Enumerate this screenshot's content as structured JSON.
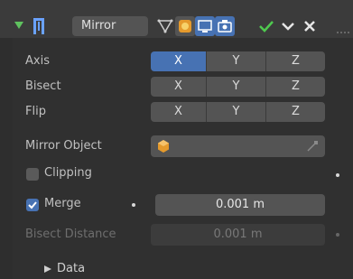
{
  "header": {
    "modifier_name": "Mirror",
    "icons": [
      "expand-arrow-icon",
      "mirror-modifier-icon",
      "edit-mode-cage-icon",
      "on-cage-icon",
      "realtime-display-icon",
      "render-icon",
      "apply-checkmark-icon",
      "dropdown-icon",
      "close-icon"
    ]
  },
  "properties": {
    "axis": {
      "label": "Axis",
      "options": [
        "X",
        "Y",
        "Z"
      ],
      "active": "X"
    },
    "bisect": {
      "label": "Bisect",
      "options": [
        "X",
        "Y",
        "Z"
      ]
    },
    "flip": {
      "label": "Flip",
      "options": [
        "X",
        "Y",
        "Z"
      ]
    },
    "mirror_object": {
      "label": "Mirror Object",
      "value": ""
    },
    "clipping": {
      "label": "Clipping",
      "checked": false
    },
    "merge": {
      "label": "Merge",
      "checked": true,
      "value": "0.001 m"
    },
    "bisect_distance": {
      "label": "Bisect Distance",
      "value": "0.001 m"
    }
  },
  "subpanels": {
    "data": "Data"
  },
  "colors": {
    "accent": "#4772b3",
    "checkmark": "#4fc94f",
    "object_icon": "#e59a2c"
  }
}
